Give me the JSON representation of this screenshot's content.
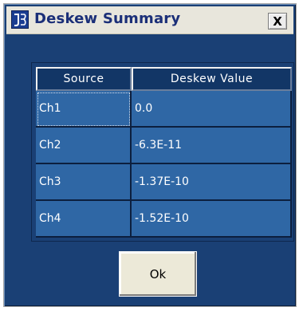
{
  "window": {
    "title": "Deskew Summary",
    "close_label": "X"
  },
  "table": {
    "columns": [
      "Source",
      "Deskew Value"
    ],
    "rows": [
      [
        "Ch1",
        "0.0"
      ],
      [
        "Ch2",
        "-6.3E-11"
      ],
      [
        "Ch3",
        "-1.37E-10"
      ],
      [
        "Ch4",
        "-1.52E-10"
      ]
    ]
  },
  "footer": {
    "ok_label": "Ok"
  }
}
